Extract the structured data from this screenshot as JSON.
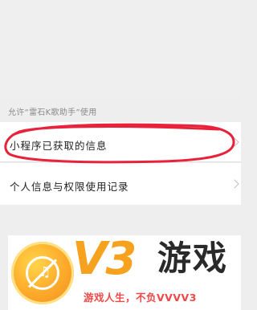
{
  "section": {
    "label": "允许“雷石K歌助手”使用"
  },
  "rows": [
    {
      "label": "小程序已获取的信息",
      "chevron": "chevron-right-icon"
    },
    {
      "label": "个人信息与权限使用记录",
      "chevron": "chevron-right-icon"
    }
  ],
  "annotation": {
    "color": "#e8223a"
  },
  "watermark": {
    "logo_text": "V3",
    "brand_text": "游戏",
    "slogan": "游戏人生，不负VVVV3",
    "note_glyph": "♫",
    "accent_color": "#f6a21e",
    "slogan_color": "#f04848"
  }
}
